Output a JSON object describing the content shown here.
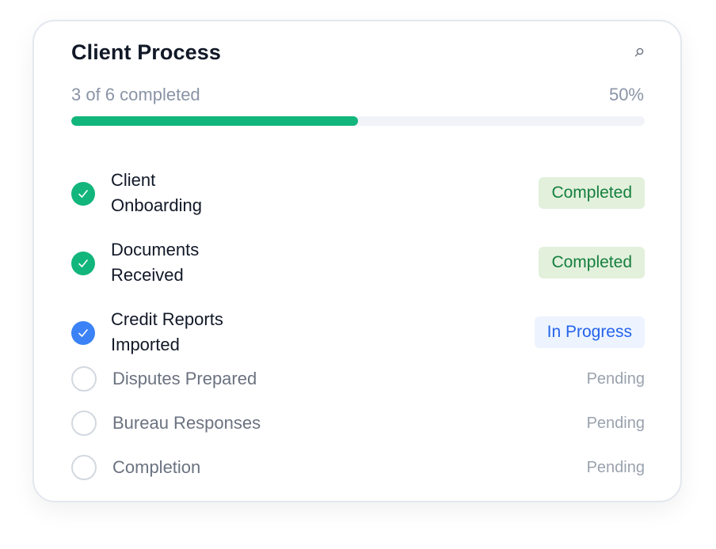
{
  "card": {
    "title": "Client Process",
    "progress_text": "3 of 6 completed",
    "progress_percent_label": "50%",
    "progress_fraction": 0.5
  },
  "colors": {
    "completed": "#12b57c",
    "in_progress": "#3b82f6",
    "pending_border": "#d3d8e0"
  },
  "steps": [
    {
      "label_line1": "Client",
      "label_line2": "Onboarding",
      "status": "Completed",
      "state": "completed",
      "icon": "check-circle-icon"
    },
    {
      "label_line1": "Documents",
      "label_line2": "Received",
      "status": "Completed",
      "state": "completed",
      "icon": "check-circle-icon"
    },
    {
      "label_line1": "Credit Reports",
      "label_line2": "Imported",
      "status": "In Progress",
      "state": "in-progress",
      "icon": "check-circle-icon"
    },
    {
      "label": "Disputes Prepared",
      "status": "Pending",
      "state": "pending",
      "icon": "empty-circle-icon"
    },
    {
      "label": "Bureau Responses",
      "status": "Pending",
      "state": "pending",
      "icon": "empty-circle-icon"
    },
    {
      "label": "Completion",
      "status": "Pending",
      "state": "pending",
      "icon": "empty-circle-icon"
    }
  ]
}
